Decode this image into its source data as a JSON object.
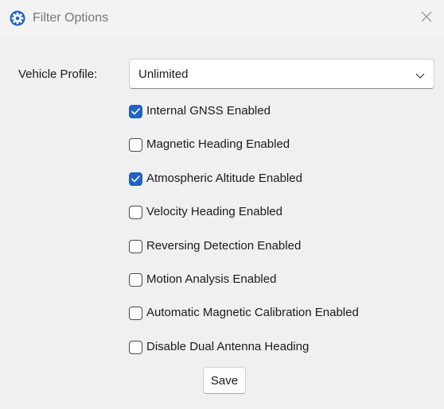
{
  "window": {
    "title": "Filter Options",
    "app_icon": "gear-icon",
    "close_icon": "close-icon"
  },
  "vehicle_profile": {
    "label": "Vehicle Profile:",
    "selected": "Unlimited",
    "dropdown_icon": "chevron-down-icon"
  },
  "options": [
    {
      "label": "Internal GNSS Enabled",
      "checked": true
    },
    {
      "label": "Magnetic Heading Enabled",
      "checked": false
    },
    {
      "label": "Atmospheric Altitude Enabled",
      "checked": true
    },
    {
      "label": "Velocity Heading Enabled",
      "checked": false
    },
    {
      "label": "Reversing Detection Enabled",
      "checked": false
    },
    {
      "label": "Motion Analysis Enabled",
      "checked": false
    },
    {
      "label": "Automatic Magnetic Calibration Enabled",
      "checked": false
    },
    {
      "label": "Disable Dual Antenna Heading",
      "checked": false
    }
  ],
  "save_label": "Save",
  "colors": {
    "checkbox_checked": "#1f63c4",
    "background": "#f0f0f0"
  }
}
